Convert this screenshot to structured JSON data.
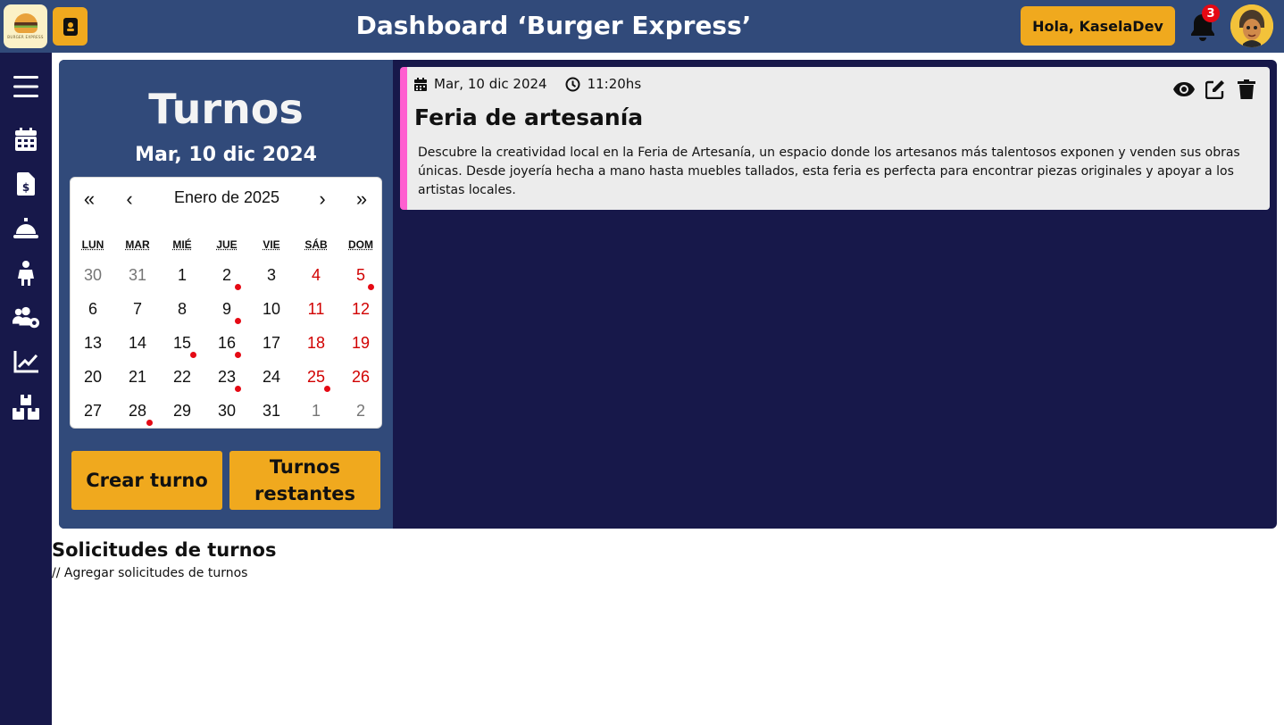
{
  "header": {
    "logo_text": "BURGER EXPRESS",
    "title": "Dashboard ‘Burger Express’",
    "greeting": "Hola, KaselaDev",
    "notification_count": "3"
  },
  "sidebar": {
    "items": [
      {
        "icon": "menu-icon"
      },
      {
        "icon": "calendar-icon"
      },
      {
        "icon": "invoice-icon"
      },
      {
        "icon": "service-bell-icon"
      },
      {
        "icon": "person-icon"
      },
      {
        "icon": "users-settings-icon"
      },
      {
        "icon": "chart-line-icon"
      },
      {
        "icon": "boxes-icon"
      }
    ]
  },
  "turnos": {
    "title": "Turnos",
    "selected_date": "Mar, 10 dic 2024",
    "calendar": {
      "nav_first": "«",
      "nav_prev": "‹",
      "month_label": "Enero de 2025",
      "nav_next": "›",
      "nav_last": "»",
      "weekdays": [
        "LUN",
        "MAR",
        "MIÉ",
        "JUE",
        "VIE",
        "SÁB",
        "DOM"
      ],
      "weeks": [
        [
          "30",
          "31",
          "1",
          "2",
          "3",
          "4",
          "5"
        ],
        [
          "6",
          "7",
          "8",
          "9",
          "10",
          "11",
          "12"
        ],
        [
          "13",
          "14",
          "15",
          "16",
          "17",
          "18",
          "19"
        ],
        [
          "20",
          "21",
          "22",
          "23",
          "24",
          "25",
          "26"
        ],
        [
          "27",
          "28",
          "29",
          "30",
          "31",
          "1",
          "2"
        ]
      ]
    },
    "create_button": "Crear turno",
    "remaining_button_line1": "Turnos",
    "remaining_button_line2": "restantes"
  },
  "event": {
    "date": "Mar, 10 dic 2024",
    "time": "11:20hs",
    "title": "Feria de artesanía",
    "description": "Descubre la creatividad local en la Feria de Artesanía, un espacio donde los artesanos más talentosos exponen y venden sus obras únicas. Desde joyería hecha a mano hasta muebles tallados, esta feria es perfecta para encontrar piezas originales y apoyar a los artistas locales.",
    "accent_color": "#ff5fd0"
  },
  "requests": {
    "title": "Solicitudes de turnos",
    "note": "// Agregar solicitudes de turnos"
  },
  "colors": {
    "header_bg": "#314a7a",
    "sidebar_bg": "#17184a",
    "accent": "#f0a91e",
    "weekend": "#d10000",
    "event_dot": "#e50914"
  }
}
